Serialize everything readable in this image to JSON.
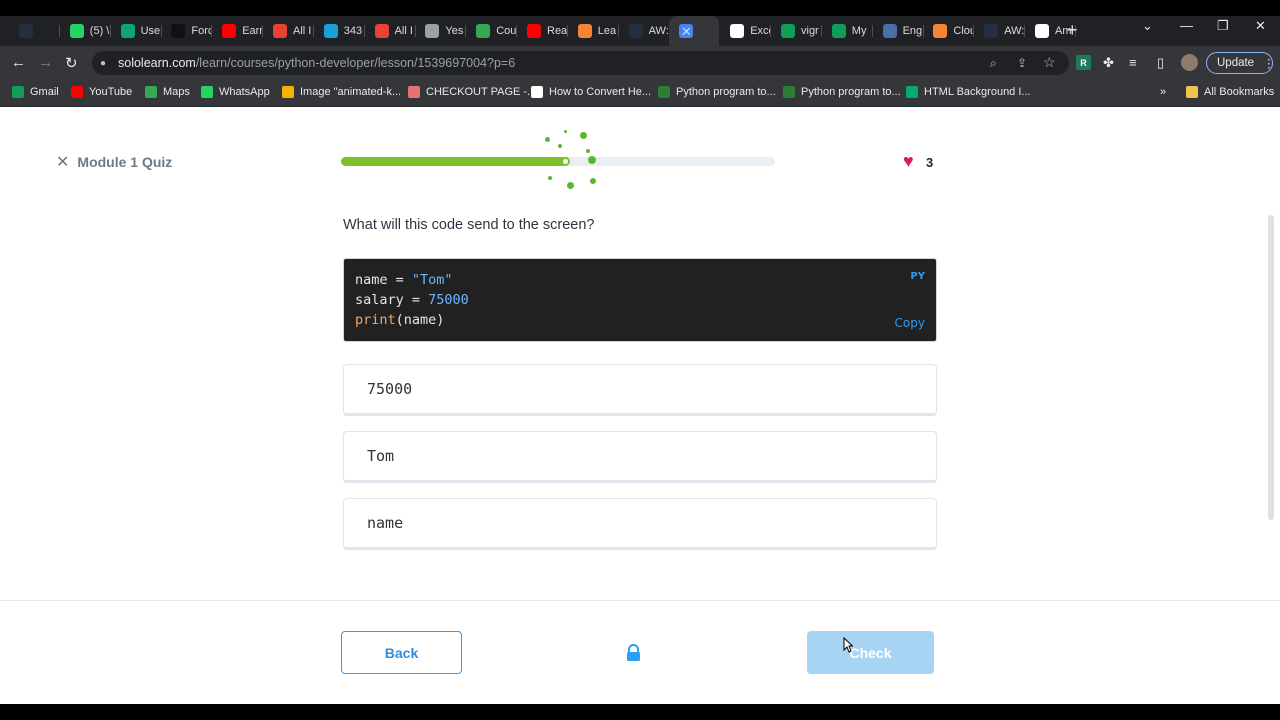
{
  "browser": {
    "tabs": [
      {
        "label": "",
        "color": "#232f3e",
        "icon": "aws-icon"
      },
      {
        "label": "(5) \\",
        "color": "#25d366",
        "icon": "whatsapp-icon"
      },
      {
        "label": "Use",
        "color": "#10a37f",
        "icon": "chatgpt-icon"
      },
      {
        "label": "Forc",
        "color": "#111111",
        "icon": "forcepoint-icon"
      },
      {
        "label": "Earr",
        "color": "#ff0000",
        "icon": "youtube-icon"
      },
      {
        "label": "All I",
        "color": "#ea4335",
        "icon": "gmail-icon"
      },
      {
        "label": "343",
        "color": "#1a9fd9",
        "icon": "is-icon"
      },
      {
        "label": "All I",
        "color": "#ea4335",
        "icon": "gmail-icon"
      },
      {
        "label": "Yes",
        "color": "#9aa0a6",
        "icon": "globe-icon"
      },
      {
        "label": "Cou",
        "color": "#34a853",
        "icon": "play-icon"
      },
      {
        "label": "Rea",
        "color": "#ff0000",
        "icon": "youtube-icon"
      },
      {
        "label": "Lea",
        "color": "#f58536",
        "icon": "cube-icon"
      },
      {
        "label": "AW:",
        "color": "#232f3e",
        "icon": "aws-icon"
      },
      {
        "label": "",
        "color": "#4285f4",
        "icon": "loading-icon",
        "active": true
      },
      {
        "label": "Exce",
        "color": "#ffffff",
        "icon": "exce-icon"
      },
      {
        "label": "vigr",
        "color": "#0f9d58",
        "icon": "sheets-icon"
      },
      {
        "label": "My",
        "color": "#0f9d58",
        "icon": "sheets-icon"
      },
      {
        "label": "Eng",
        "color": "#4a6fa5",
        "icon": "d-icon"
      },
      {
        "label": "Clou",
        "color": "#f58536",
        "icon": "cube-icon"
      },
      {
        "label": "AW:",
        "color": "#232f3e",
        "icon": "aws-icon"
      },
      {
        "label": "Am",
        "color": "#ffffff",
        "icon": "amazon-icon"
      }
    ],
    "url_host": "sololearn.com",
    "url_path": "/learn/courses/python-developer/lesson/1539697004?p=6",
    "update_label": "Update",
    "bookmarks": [
      {
        "label": "Gmail",
        "color": "#0f9d58",
        "icon": "gmail-bookmark-icon"
      },
      {
        "label": "YouTube",
        "color": "#ff0000",
        "icon": "youtube-icon"
      },
      {
        "label": "Maps",
        "color": "#34a853",
        "icon": "maps-icon"
      },
      {
        "label": "WhatsApp",
        "color": "#25d366",
        "icon": "whatsapp-icon"
      },
      {
        "label": "Image \"animated-k...",
        "color": "#f4b400",
        "icon": "star-icon"
      },
      {
        "label": "CHECKOUT PAGE -...",
        "color": "#e57373",
        "icon": "lips-icon"
      },
      {
        "label": "How to Convert He...",
        "color": "#ffffff",
        "icon": "alpha-icon"
      },
      {
        "label": "Python program to...",
        "color": "#2e7d32",
        "icon": "gfg-icon"
      },
      {
        "label": "Python program to...",
        "color": "#2e7d32",
        "icon": "gfg-icon"
      },
      {
        "label": "HTML Background I...",
        "color": "#04aa6d",
        "icon": "w3-icon"
      }
    ],
    "all_bookmarks_label": "All Bookmarks"
  },
  "quiz": {
    "title": "Module 1 Quiz",
    "progress": 0.52,
    "lives": "3",
    "question": "What will this code send to the screen?",
    "code": {
      "language": "PY",
      "copy_label": "Copy",
      "line1_var": "name",
      "line1_eq": " = ",
      "line1_val": "\"Tom\"",
      "line2_var": "salary",
      "line2_eq": " = ",
      "line2_val": "75000",
      "line3_fn": "print",
      "line3_args": "(name)"
    },
    "options": [
      "75000",
      "Tom",
      "name"
    ],
    "back_label": "Back",
    "check_label": "Check"
  },
  "colors": {
    "accent": "#2a9df4",
    "progress": "#7cc02a",
    "heart": "#d81b60"
  }
}
